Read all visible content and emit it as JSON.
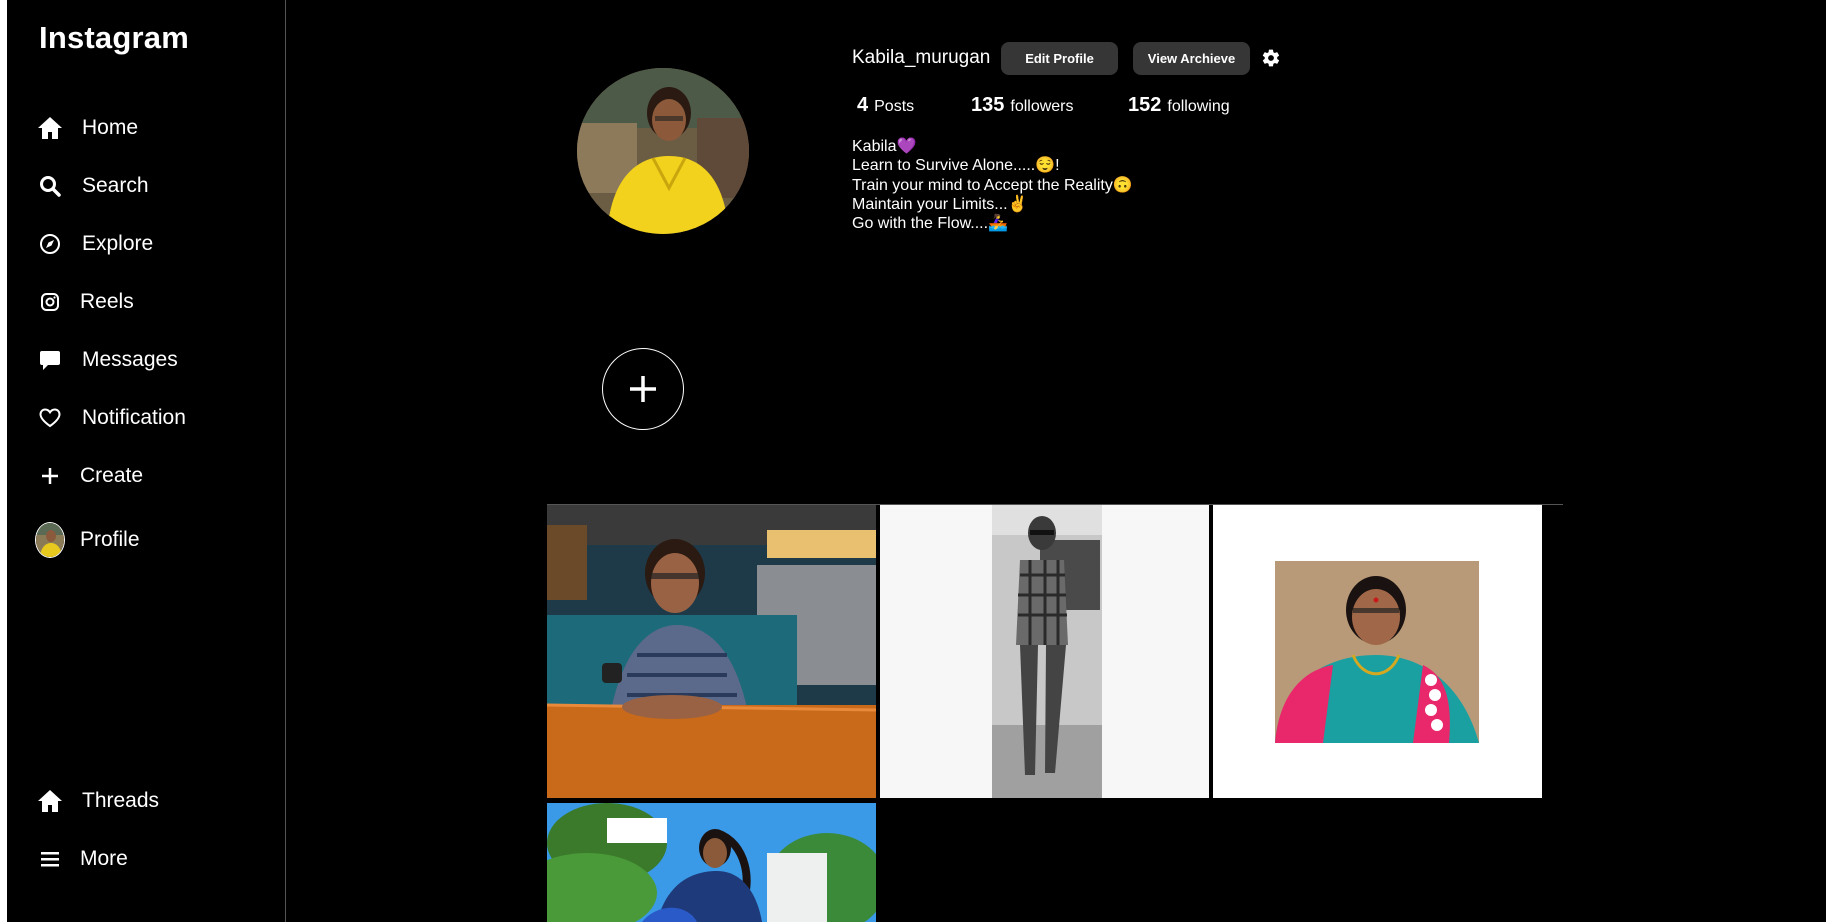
{
  "sidebar": {
    "logo": "Instagram",
    "items": [
      {
        "label": "Home",
        "icon": "home-icon"
      },
      {
        "label": "Search",
        "icon": "search-icon"
      },
      {
        "label": "Explore",
        "icon": "compass-icon"
      },
      {
        "label": "Reels",
        "icon": "reels-icon"
      },
      {
        "label": "Messages",
        "icon": "message-icon"
      },
      {
        "label": "Notification",
        "icon": "heart-icon"
      },
      {
        "label": "Create",
        "icon": "plus-icon"
      },
      {
        "label": "Profile",
        "icon": "avatar"
      }
    ],
    "bottom_items": [
      {
        "label": "Threads",
        "icon": "home-icon"
      },
      {
        "label": "More",
        "icon": "menu-icon"
      }
    ]
  },
  "profile": {
    "username": "Kabila_murugan",
    "edit_profile_label": "Edit Profile",
    "view_archive_label": "View Archieve",
    "posts_count": "4",
    "posts_label": "Posts",
    "followers_count": "135",
    "followers_label": "followers",
    "following_count": "152",
    "following_label": "following",
    "bio": [
      "Kabila💜",
      "Learn to Survive Alone.....😌!",
      "Train your mind to Accept the Reality🙃",
      "Maintain your Limits...✌️",
      "Go with the Flow....🚣‍♀️"
    ]
  },
  "colors": {
    "background": "#000000",
    "button": "#363636",
    "text": "#ffffff"
  }
}
